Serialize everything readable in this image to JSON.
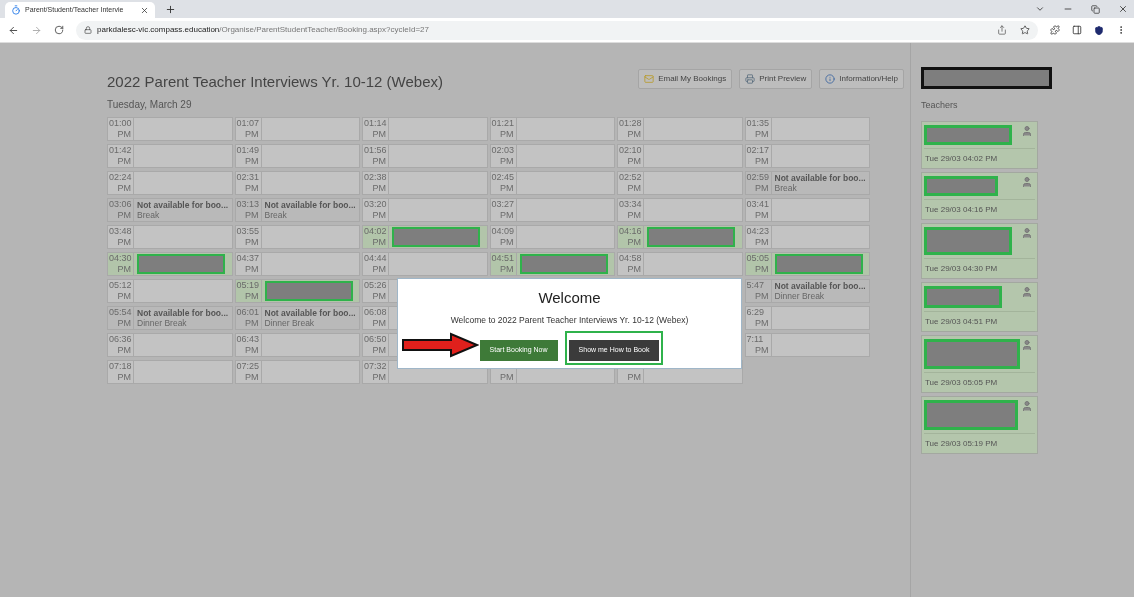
{
  "browser": {
    "tab_title": "Parent/Student/Teacher Intervie",
    "url_host": "parkdalesc-vic.compass.education",
    "url_path": "/Organise/ParentStudentTeacher/Booking.aspx?cycleId=27"
  },
  "page": {
    "title": "2022 Parent Teacher Interviews Yr. 10-12 (Webex)",
    "date": "Tuesday, March 29",
    "actions": [
      "Email My Bookings",
      "Print Preview",
      "Information/Help"
    ]
  },
  "slots": [
    [
      {
        "kind": "open",
        "time": "01:00",
        "ampm": "PM"
      },
      {
        "kind": "open",
        "time": "01:07",
        "ampm": "PM"
      },
      {
        "kind": "open",
        "time": "01:14",
        "ampm": "PM"
      },
      {
        "kind": "open",
        "time": "01:21",
        "ampm": "PM"
      },
      {
        "kind": "open",
        "time": "01:28",
        "ampm": "PM"
      },
      {
        "kind": "open",
        "time": "01:35",
        "ampm": "PM"
      }
    ],
    [
      {
        "kind": "open",
        "time": "01:42",
        "ampm": "PM"
      },
      {
        "kind": "open",
        "time": "01:49",
        "ampm": "PM"
      },
      {
        "kind": "open",
        "time": "01:56",
        "ampm": "PM"
      },
      {
        "kind": "open",
        "time": "02:03",
        "ampm": "PM"
      },
      {
        "kind": "open",
        "time": "02:10",
        "ampm": "PM"
      },
      {
        "kind": "open",
        "time": "02:17",
        "ampm": "PM"
      }
    ],
    [
      {
        "kind": "open",
        "time": "02:24",
        "ampm": "PM"
      },
      {
        "kind": "open",
        "time": "02:31",
        "ampm": "PM"
      },
      {
        "kind": "open",
        "time": "02:38",
        "ampm": "PM"
      },
      {
        "kind": "open",
        "time": "02:45",
        "ampm": "PM"
      },
      {
        "kind": "open",
        "time": "02:52",
        "ampm": "PM"
      },
      {
        "kind": "unavailable",
        "time": "02:59",
        "ampm": "PM",
        "title": "Not available for boo...",
        "note": "Break"
      }
    ],
    [
      {
        "kind": "unavailable",
        "time": "03:06",
        "ampm": "PM",
        "title": "Not available for boo...",
        "note": "Break"
      },
      {
        "kind": "unavailable",
        "time": "03:13",
        "ampm": "PM",
        "title": "Not available for boo...",
        "note": "Break"
      },
      {
        "kind": "open",
        "time": "03:20",
        "ampm": "PM"
      },
      {
        "kind": "open",
        "time": "03:27",
        "ampm": "PM"
      },
      {
        "kind": "open",
        "time": "03:34",
        "ampm": "PM"
      },
      {
        "kind": "open",
        "time": "03:41",
        "ampm": "PM"
      }
    ],
    [
      {
        "kind": "open",
        "time": "03:48",
        "ampm": "PM"
      },
      {
        "kind": "open",
        "time": "03:55",
        "ampm": "PM"
      },
      {
        "kind": "booked",
        "time": "04:02",
        "ampm": "PM"
      },
      {
        "kind": "open",
        "time": "04:09",
        "ampm": "PM"
      },
      {
        "kind": "booked",
        "time": "04:16",
        "ampm": "PM"
      },
      {
        "kind": "open",
        "time": "04:23",
        "ampm": "PM"
      }
    ],
    [
      {
        "kind": "booked",
        "time": "04:30",
        "ampm": "PM"
      },
      {
        "kind": "open",
        "time": "04:37",
        "ampm": "PM"
      },
      {
        "kind": "open",
        "time": "04:44",
        "ampm": "PM"
      },
      {
        "kind": "booked",
        "time": "04:51",
        "ampm": "PM"
      },
      {
        "kind": "open",
        "time": "04:58",
        "ampm": "PM"
      },
      {
        "kind": "booked",
        "time": "05:05",
        "ampm": "PM"
      }
    ],
    [
      {
        "kind": "open",
        "time": "05:12",
        "ampm": "PM"
      },
      {
        "kind": "booked",
        "time": "05:19",
        "ampm": "PM"
      },
      {
        "kind": "open",
        "time": "05:26",
        "ampm": "PM"
      },
      {
        "kind": "hidden"
      },
      {
        "kind": "hidden"
      },
      {
        "kind": "unavailable",
        "time": "5:47",
        "ampm": "PM",
        "title": "Not available for boo...",
        "note": "Dinner Break"
      }
    ],
    [
      {
        "kind": "unavailable",
        "time": "05:54",
        "ampm": "PM",
        "title": "Not available for boo...",
        "note": "Dinner Break"
      },
      {
        "kind": "unavailable",
        "time": "06:01",
        "ampm": "PM",
        "title": "Not available for boo...",
        "note": "Dinner Break"
      },
      {
        "kind": "open",
        "time": "06:08",
        "ampm": "PM"
      },
      {
        "kind": "hidden"
      },
      {
        "kind": "hidden"
      },
      {
        "kind": "open",
        "time": "6:29",
        "ampm": "PM"
      }
    ],
    [
      {
        "kind": "open",
        "time": "06:36",
        "ampm": "PM"
      },
      {
        "kind": "open",
        "time": "06:43",
        "ampm": "PM"
      },
      {
        "kind": "open",
        "time": "06:50",
        "ampm": "PM"
      },
      {
        "kind": "hidden"
      },
      {
        "kind": "hidden"
      },
      {
        "kind": "open",
        "time": "7:11",
        "ampm": "PM"
      }
    ],
    [
      {
        "kind": "open",
        "time": "07:18",
        "ampm": "PM"
      },
      {
        "kind": "open",
        "time": "07:25",
        "ampm": "PM"
      },
      {
        "kind": "open",
        "time": "07:32",
        "ampm": "PM"
      },
      {
        "kind": "open",
        "ampm": "PM"
      },
      {
        "kind": "open",
        "ampm": "PM"
      }
    ]
  ],
  "modal": {
    "title": "Welcome",
    "message": "Welcome to 2022 Parent Teacher Interviews Yr. 10-12 (Webex)",
    "buttons": [
      {
        "label": "Start Booking Now",
        "kind": "primary",
        "highlighted": false
      },
      {
        "label": "Show me How to Book",
        "kind": "secondary",
        "highlighted": true
      }
    ]
  },
  "sidebar": {
    "heading": "Teachers",
    "teachers": [
      {
        "time": "Tue 29/03 04:02 PM"
      },
      {
        "time": "Tue 29/03 04:16 PM"
      },
      {
        "time": "Tue 29/03 04:30 PM"
      },
      {
        "time": "Tue 29/03 04:51 PM"
      },
      {
        "time": "Tue 29/03 05:05 PM"
      },
      {
        "time": "Tue 29/03 05:19 PM"
      }
    ]
  }
}
